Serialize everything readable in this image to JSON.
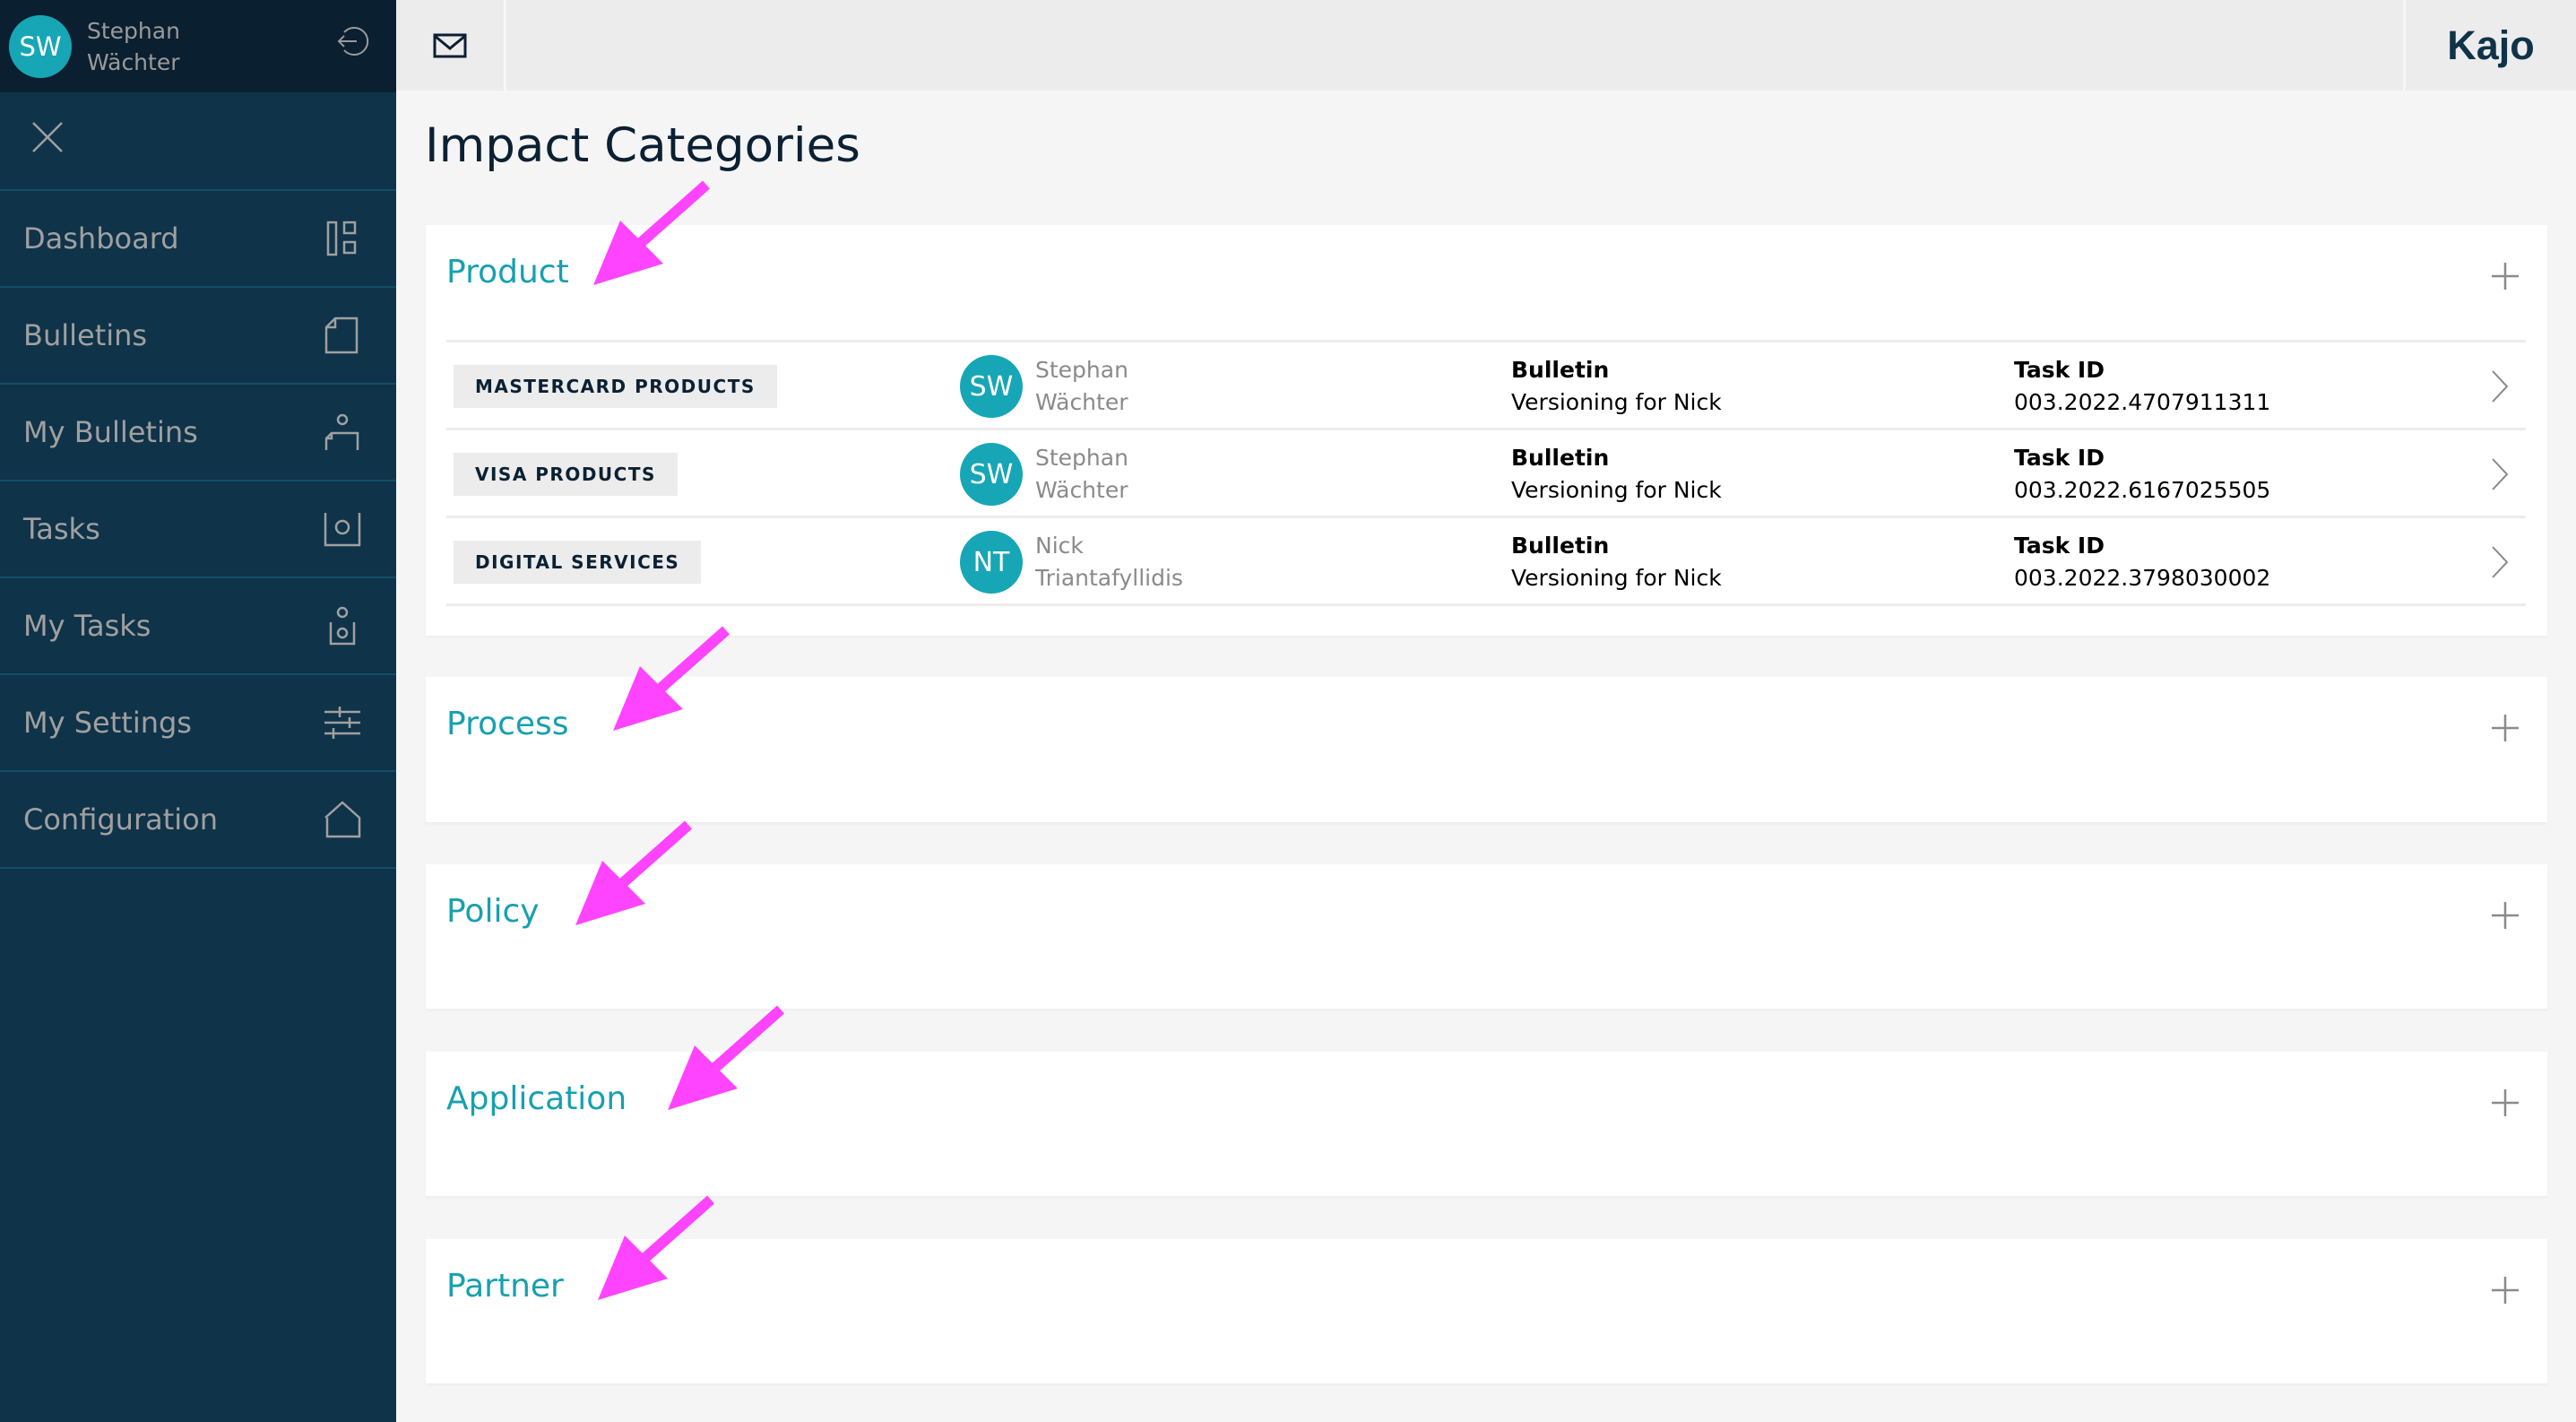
{
  "user": {
    "initials": "SW",
    "first_name": "Stephan",
    "last_name": "Wächter"
  },
  "sidebar": {
    "items": [
      {
        "label": "Dashboard",
        "icon": "dashboard-icon"
      },
      {
        "label": "Bulletins",
        "icon": "document-icon"
      },
      {
        "label": "My Bulletins",
        "icon": "user-document-icon"
      },
      {
        "label": "Tasks",
        "icon": "task-icon"
      },
      {
        "label": "My Tasks",
        "icon": "user-task-icon"
      },
      {
        "label": "My Settings",
        "icon": "sliders-icon"
      },
      {
        "label": "Configuration",
        "icon": "home-icon"
      }
    ]
  },
  "topbar": {
    "brand": "Kajo"
  },
  "page": {
    "title": "Impact Categories"
  },
  "categories": [
    {
      "title": "Product",
      "expanded": true,
      "rows": [
        {
          "tag": "MASTERCARD PRODUCTS",
          "initials": "SW",
          "first_name": "Stephan",
          "last_name": "Wächter",
          "bulletin_label": "Bulletin",
          "bulletin_value": "Versioning for Nick",
          "task_label": "Task ID",
          "task_value": "003.2022.4707911311"
        },
        {
          "tag": "VISA PRODUCTS",
          "initials": "SW",
          "first_name": "Stephan",
          "last_name": "Wächter",
          "bulletin_label": "Bulletin",
          "bulletin_value": "Versioning for Nick",
          "task_label": "Task ID",
          "task_value": "003.2022.6167025505"
        },
        {
          "tag": "DIGITAL SERVICES",
          "initials": "NT",
          "first_name": "Nick",
          "last_name": "Triantafyllidis",
          "bulletin_label": "Bulletin",
          "bulletin_value": "Versioning for Nick",
          "task_label": "Task ID",
          "task_value": "003.2022.3798030002"
        }
      ]
    },
    {
      "title": "Process",
      "expanded": false
    },
    {
      "title": "Policy",
      "expanded": false
    },
    {
      "title": "Application",
      "expanded": false
    },
    {
      "title": "Partner",
      "expanded": false
    }
  ],
  "colors": {
    "sidebar": "#0f3349",
    "sidebar_header": "#0a1f30",
    "accent": "#17a6b5",
    "annotation_arrow": "#ff44ff"
  }
}
